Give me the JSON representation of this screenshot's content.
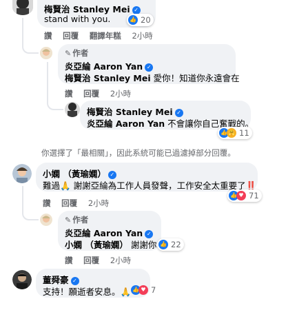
{
  "comment1": {
    "author": "梅賢治 Stanley Mei",
    "text": "stand with you.",
    "reaction_count": "20",
    "actions": [
      "讚",
      "回覆",
      "翻譯年糕",
      "2小時"
    ]
  },
  "reply1": {
    "author_tag": "作者",
    "author": "炎亞綸 Aaron Yan",
    "mention": "梅賢治 Stanley Mei",
    "text": " 愛你！知道你永遠會在",
    "actions": [
      "讚",
      "回覆",
      "2小時"
    ]
  },
  "reply2": {
    "author": "梅賢治 Stanley Mei",
    "mention": "炎亞綸 Aaron Yan",
    "text": " 不會讓你自己奮戰的。",
    "reaction_count": "11",
    "actions": [
      "讚",
      "回覆",
      "2小時"
    ]
  },
  "filter_notice": "你選擇了「最相關」，因此系統可能已過濾掉部分回覆。",
  "comment2": {
    "author": "小嫻 （黃瑜嫻）",
    "text_prefix": "難過",
    "text": " 謝謝亞綸為工作人員發聲，工作安全太重要了",
    "text_suffix": "‼️",
    "reaction_count": "71",
    "actions": [
      "讚",
      "回覆",
      "2小時"
    ]
  },
  "reply3": {
    "author_tag": "作者",
    "author": "炎亞綸 Aaron Yan",
    "mention": "小嫻 （黃瑜嫻）",
    "text": " 謝謝你",
    "reaction_count": "22",
    "actions": [
      "讚",
      "回覆",
      "2小時"
    ]
  },
  "comment3": {
    "author": "董舜豪",
    "text": "支持！願逝者安息。",
    "reaction_count": "7"
  },
  "colors": {
    "bubble": "#f0f2f5",
    "link": "#1877f2",
    "meta": "#65676b"
  }
}
